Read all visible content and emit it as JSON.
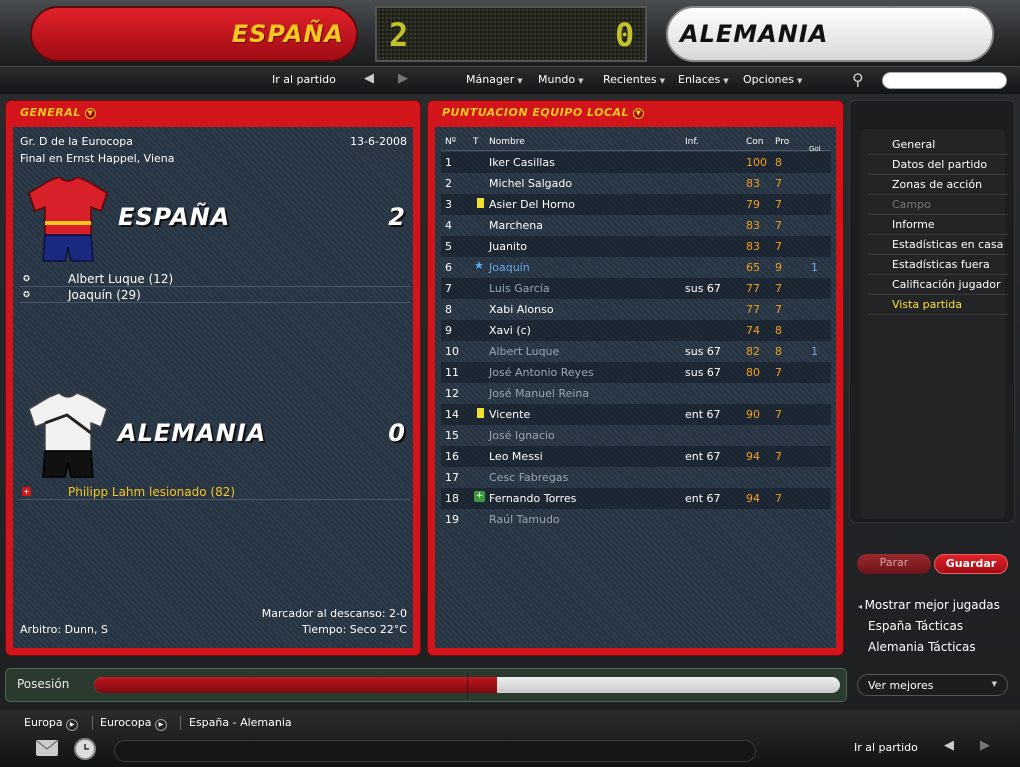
{
  "header": {
    "home_team": "ESPAÑA",
    "away_team": "ALEMANIA",
    "home_score": "2",
    "away_score": "0"
  },
  "menubar": {
    "go_to_match": "Ir al partido",
    "items": [
      "Mánager",
      "Mundo",
      "Recientes",
      "Enlaces",
      "Opciones"
    ],
    "search_placeholder": ""
  },
  "general_panel": {
    "title": "GENERAL",
    "competition": "Gr. D de la Eurocopa",
    "date": "13-6-2008",
    "venue": "Final en Ernst Happel, Viena",
    "home": {
      "name": "ESPAÑA",
      "score": "2",
      "events": [
        "Albert Luque (12)",
        "Joaquín (29)"
      ]
    },
    "away": {
      "name": "ALEMANIA",
      "score": "0",
      "events": [
        "Philipp Lahm lesionado (82)"
      ]
    },
    "halftime": "Marcador al descanso: 2-0",
    "referee": "Arbitro: Dunn, S",
    "weather": "Tiempo: Seco 22°C"
  },
  "ratings_panel": {
    "title": "PUNTUACION EQUIPO LOCAL",
    "columns": [
      "Nº",
      "T",
      "Nombre",
      "Inf.",
      "Con",
      "Pro",
      "Gol"
    ],
    "rows": [
      {
        "n": "1",
        "name": "Iker Casillas",
        "inf": "",
        "con": "100",
        "pro": "8",
        "x": "",
        "mark": "",
        "sub": false
      },
      {
        "n": "2",
        "name": "Michel Salgado",
        "inf": "",
        "con": "83",
        "pro": "7",
        "x": "",
        "mark": "",
        "sub": false
      },
      {
        "n": "3",
        "name": "Asier Del Horno",
        "inf": "",
        "con": "79",
        "pro": "7",
        "x": "",
        "mark": "yellow",
        "sub": false
      },
      {
        "n": "4",
        "name": "Marchena",
        "inf": "",
        "con": "83",
        "pro": "7",
        "x": "",
        "mark": "",
        "sub": false
      },
      {
        "n": "5",
        "name": "Juanito",
        "inf": "",
        "con": "83",
        "pro": "7",
        "x": "",
        "mark": "",
        "sub": false
      },
      {
        "n": "6",
        "name": "Joaquín",
        "inf": "",
        "con": "65",
        "pro": "9",
        "x": "1",
        "mark": "star",
        "sub": false
      },
      {
        "n": "7",
        "name": "Luis García",
        "inf": "sus 67",
        "con": "77",
        "pro": "7",
        "x": "",
        "mark": "",
        "sub": true
      },
      {
        "n": "8",
        "name": "Xabi Alonso",
        "inf": "",
        "con": "77",
        "pro": "7",
        "x": "",
        "mark": "",
        "sub": false
      },
      {
        "n": "9",
        "name": "Xavi (c)",
        "inf": "",
        "con": "74",
        "pro": "8",
        "x": "",
        "mark": "",
        "sub": false
      },
      {
        "n": "10",
        "name": "Albert Luque",
        "inf": "sus 67",
        "con": "82",
        "pro": "8",
        "x": "1",
        "mark": "",
        "sub": true
      },
      {
        "n": "11",
        "name": "José Antonio Reyes",
        "inf": "sus 67",
        "con": "80",
        "pro": "7",
        "x": "",
        "mark": "",
        "sub": true
      },
      {
        "n": "12",
        "name": "José Manuel Reina",
        "inf": "",
        "con": "",
        "pro": "",
        "x": "",
        "mark": "",
        "sub": true
      },
      {
        "n": "14",
        "name": "Vicente",
        "inf": "ent 67",
        "con": "90",
        "pro": "7",
        "x": "",
        "mark": "yellow",
        "sub": false
      },
      {
        "n": "15",
        "name": "José Ignacio",
        "inf": "",
        "con": "",
        "pro": "",
        "x": "",
        "mark": "",
        "sub": true
      },
      {
        "n": "16",
        "name": "Leo Messi",
        "inf": "ent 67",
        "con": "94",
        "pro": "7",
        "x": "",
        "mark": "",
        "sub": false
      },
      {
        "n": "17",
        "name": "Cesc Fabregas",
        "inf": "",
        "con": "",
        "pro": "",
        "x": "",
        "mark": "",
        "sub": true
      },
      {
        "n": "18",
        "name": "Fernando Torres",
        "inf": "ent 67",
        "con": "94",
        "pro": "7",
        "x": "",
        "mark": "plus",
        "sub": false
      },
      {
        "n": "19",
        "name": "Raúl Tamudo",
        "inf": "",
        "con": "",
        "pro": "",
        "x": "",
        "mark": "",
        "sub": true
      }
    ]
  },
  "side_menu": {
    "items": [
      {
        "label": "General",
        "state": "normal"
      },
      {
        "label": "Datos del partido",
        "state": "normal"
      },
      {
        "label": "Zonas de acción",
        "state": "normal"
      },
      {
        "label": "Campo",
        "state": "disabled"
      },
      {
        "label": "Informe",
        "state": "normal"
      },
      {
        "label": "Estadísticas en casa",
        "state": "normal"
      },
      {
        "label": "Estadísticas fuera",
        "state": "normal"
      },
      {
        "label": "Calificación jugador",
        "state": "normal"
      },
      {
        "label": "Vista partida",
        "state": "active"
      }
    ],
    "stop_button": "Parar",
    "save_button": "Guardar",
    "links": [
      "Mostrar mejor jugadas",
      "España Tácticas",
      "Alemania Tácticas"
    ],
    "dropdown": "Ver mejores"
  },
  "possession": {
    "label": "Posesión",
    "home_fraction": 0.54
  },
  "footer": {
    "breadcrumbs": [
      "Europa",
      "Eurocopa",
      "España - Alemania"
    ],
    "go_to_match": "Ir al partido"
  },
  "colors": {
    "accent_red": "#d2141b",
    "gold": "#f6c621",
    "rating_orange": "#f0a020"
  }
}
